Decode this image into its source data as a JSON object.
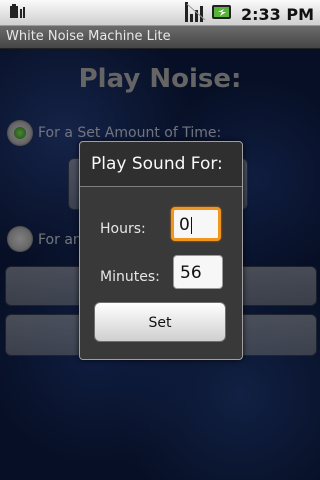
{
  "status_bar": {
    "time": "2:33 PM",
    "icons": [
      "usb-debugging-icon",
      "signal-icon",
      "battery-icon"
    ]
  },
  "title_bar": {
    "title": "White Noise Machine Lite"
  },
  "main": {
    "heading": "Play Noise:",
    "option_set_amount": "For a Set Amount of Time:",
    "option_second": "For an"
  },
  "dialog": {
    "title": "Play Sound For:",
    "hours_label": "Hours:",
    "hours_value": "0",
    "minutes_label": "Minutes:",
    "minutes_value": "56",
    "set_label": "Set"
  },
  "colors": {
    "focus": "#f0961f",
    "radio_selected": "#3fae2a",
    "background": "#0d1d45"
  }
}
